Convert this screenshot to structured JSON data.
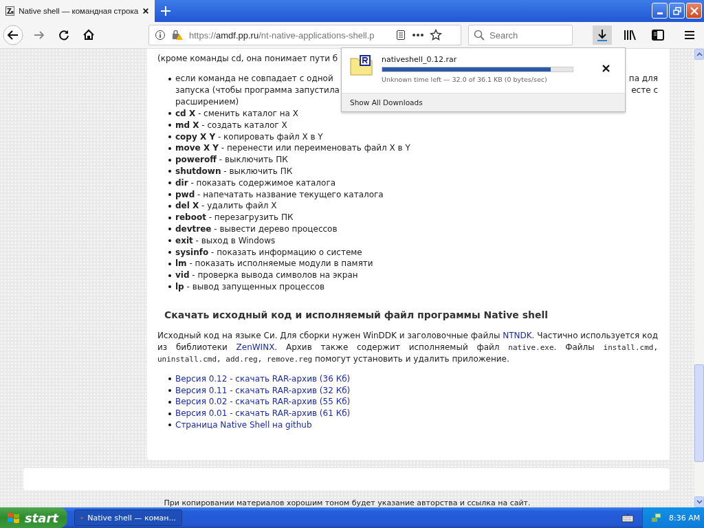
{
  "window": {
    "tab_title": "Native shell — командная строка"
  },
  "toolbar": {
    "url": {
      "scheme": "https://",
      "host": "amdf.pp.ru",
      "path": "/nt-native-applications-shell.p"
    },
    "search": {
      "placeholder": "Search"
    },
    "downloads_active": true
  },
  "downloads_panel": {
    "file": "nativeshell_0.12.rar",
    "level": 0.886,
    "status": "Unknown time left — 32.0 of 36.1 KB (0 bytes/sec)",
    "footer": "Show All Downloads"
  },
  "article": {
    "intro": "(кроме команды cd, она понимает пути б",
    "first_bullet": [
      {
        "left": "если команда не совпадает с одной",
        "right": "па для"
      },
      {
        "left": "запуска (чтобы программа запустила",
        "right": "есте с"
      },
      {
        "left": "расширением)"
      }
    ],
    "commands": [
      "**cd X** - сменить каталог на X",
      "**md X** - создать каталог X",
      "**copy X Y** - копировать файл X в Y",
      "**move X Y** - перенести или переименовать файл X в Y",
      "**poweroff** - выключить ПК",
      "**shutdown** - выключить ПК",
      "**dir** - показать содержимое каталога",
      "**pwd** - напечатать название текущего каталога",
      "**del X** - удалить файл X",
      "**reboot** - перезагрузить ПК",
      "**devtree** - вывести дерево процессов",
      "**exit** - выход в Windows",
      "**sysinfo** - показать информацию о системе",
      "**lm** - показать исполняемые модули в памяти",
      "**vid** - проверка вывода символов на экран",
      "**lp** - вывод запущенных процессов"
    ],
    "heading": "Скачать исходный код и исполняемый файл программы Native shell",
    "paragraph": [
      {
        "kind": "text",
        "text": "Исходный код на языке Си. Для сборки нужен WinDDK и заголовочные файлы "
      },
      {
        "kind": "link",
        "text": "NTNDK"
      },
      {
        "kind": "text",
        "text": ". Частично используется код из библиотеки "
      },
      {
        "kind": "link",
        "text": "ZenWINX"
      },
      {
        "kind": "text",
        "text": ". Архив также содержит исполняемый файл "
      },
      {
        "kind": "code",
        "text": "native.exe"
      },
      {
        "kind": "text",
        "text": ". Файлы "
      },
      {
        "kind": "code",
        "text": "install.cmd, uninstall.cmd, add.reg, remove.reg"
      },
      {
        "kind": "text",
        "text": " помогут установить и удалить приложение."
      }
    ],
    "downloads": [
      "Версия 0.12 - скачать RAR-архив (36 Кб)",
      "Версия 0.11 - скачать RAR-архив (32 Кб)",
      "Версия 0.02 - скачать RAR-архив (55 Кб)",
      "Версия 0.01 - скачать RAR-архив (61 Кб)",
      "Страница Native Shell на github"
    ]
  },
  "footer_note": "При копировании материалов хорошим тоном будет указание авторства и ссылка на сайт.",
  "taskbar": {
    "start": "start",
    "task": "Native shell — коман...",
    "clock": "8:36 AM"
  }
}
